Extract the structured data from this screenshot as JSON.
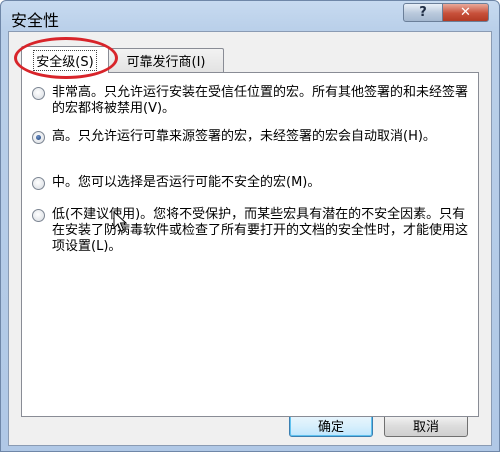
{
  "window": {
    "title": "安全性",
    "help_glyph": "?",
    "close_glyph": "✕"
  },
  "tabs": [
    {
      "label": "安全级(S)",
      "selected": true
    },
    {
      "label": "可靠发行商(I)",
      "selected": false
    }
  ],
  "options": [
    {
      "text": "非常高。只允许运行安装在受信任位置的宏。所有其他签署的和未经签署的宏都将被禁用(V)。",
      "checked": false
    },
    {
      "text": "高。只允许运行可靠来源签署的宏，未经签署的宏会自动取消(H)。",
      "checked": true
    },
    {
      "text": "中。您可以选择是否运行可能不安全的宏(M)。",
      "checked": false
    },
    {
      "text": "低(不建议使用)。您将不受保护，而某些宏具有潜在的不安全因素。只有在安装了防病毒软件或检查了所有要打开的文档的安全性时，才能使用这项设置(L)。",
      "checked": false
    }
  ],
  "buttons": {
    "ok": "确定",
    "cancel": "取消"
  },
  "colors": {
    "highlight_ring": "#d8242a",
    "close_button": "#c7503a"
  }
}
